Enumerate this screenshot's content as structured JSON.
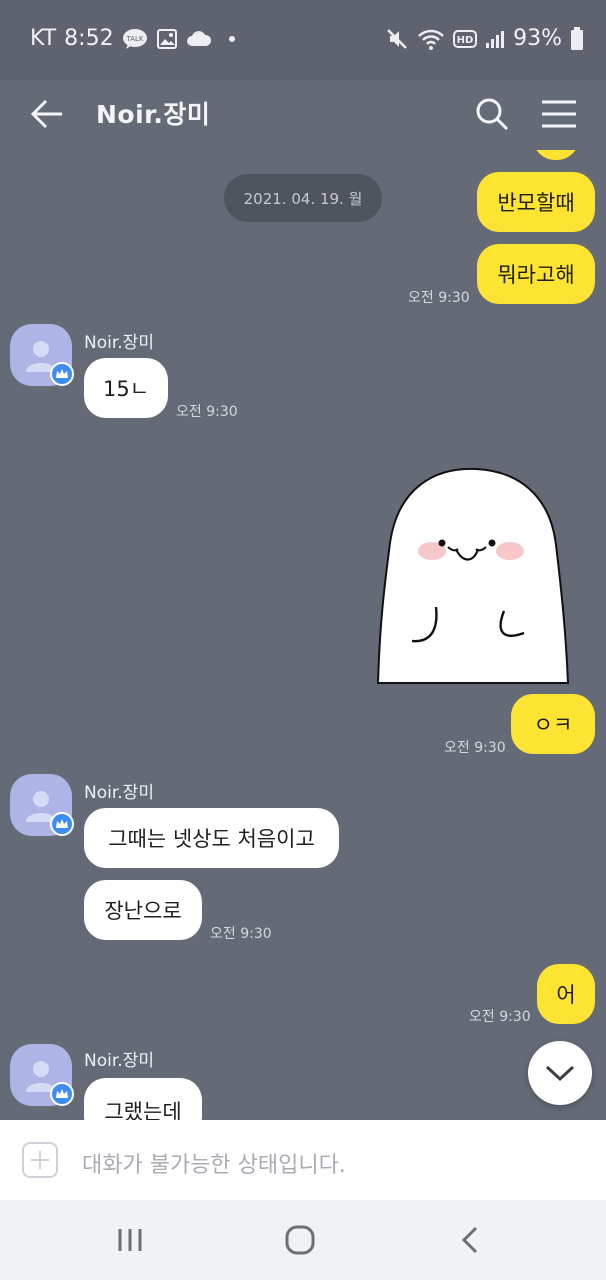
{
  "status_bar": {
    "carrier": "KT",
    "time": "8:52",
    "battery": "93%",
    "icons": [
      "talk-icon",
      "gallery-icon",
      "cloud-icon",
      "dot-icon",
      "mute-icon",
      "wifi-icon",
      "hd-icon",
      "signal-icon",
      "battery-icon"
    ]
  },
  "header": {
    "title": "Noir.장미",
    "icons": [
      "back-arrow-icon",
      "search-icon",
      "menu-icon"
    ]
  },
  "chat": {
    "date_divider": "2021. 04. 19. 월",
    "messages": [
      {
        "from": "me",
        "text": "반모할때"
      },
      {
        "from": "me",
        "text": "뭐라고해",
        "time": "오전 9:30"
      },
      {
        "from": "them",
        "sender": "Noir.장미",
        "text": "15ㄴ",
        "time": "오전 9:30"
      },
      {
        "from": "me",
        "type": "sticker",
        "sticker": "white-ghost-sticker"
      },
      {
        "from": "me",
        "text": "ㅇㅋ",
        "time": "오전 9:30"
      },
      {
        "from": "them",
        "sender": "Noir.장미",
        "text": "그때는 넷상도 처음이고"
      },
      {
        "from": "them",
        "text": "장난으로",
        "time": "오전 9:30"
      },
      {
        "from": "me",
        "text": "어",
        "time": "오전 9:30"
      },
      {
        "from": "them",
        "sender": "Noir.장미",
        "text": "그랬는데"
      }
    ]
  },
  "input": {
    "placeholder": "대화가 불가능한 상태입니다."
  },
  "colors": {
    "chat_bg": "#656a77",
    "my_bubble": "#fde433",
    "their_bubble": "#ffffff",
    "badge": "#3f8cf4"
  }
}
